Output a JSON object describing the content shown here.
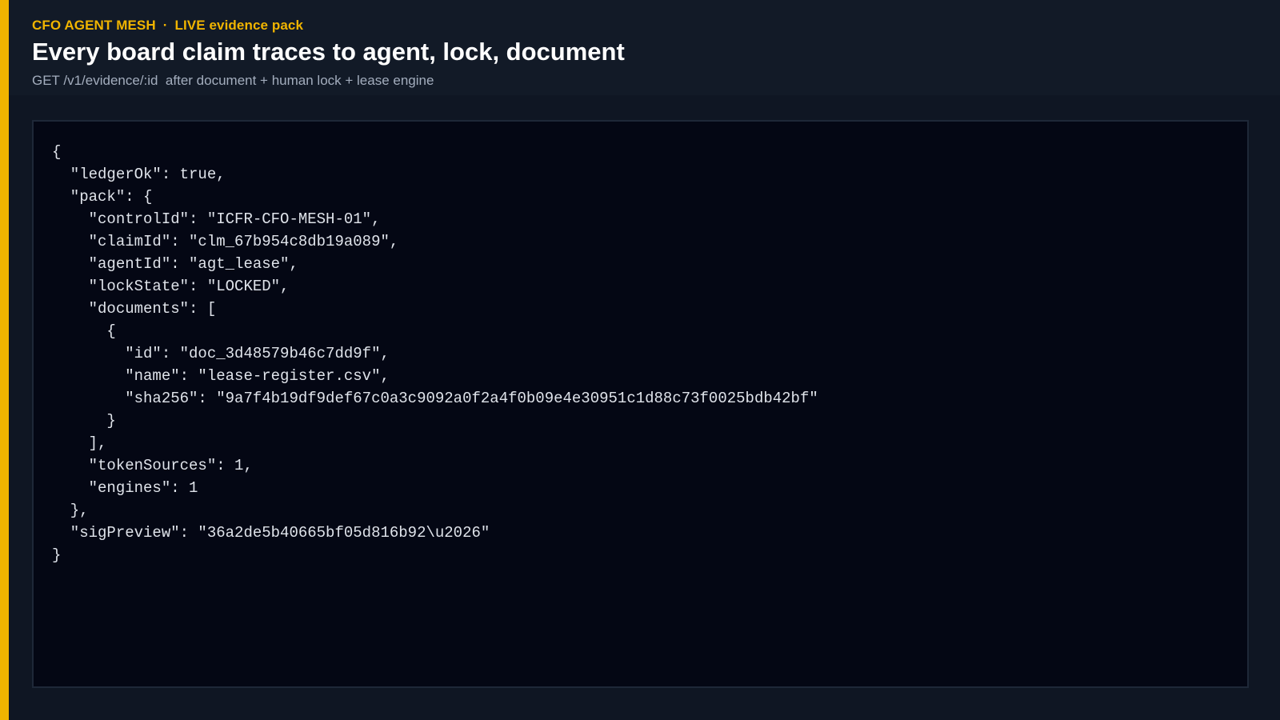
{
  "header": {
    "brand": "CFO AGENT MESH",
    "separator": "·",
    "status": "LIVE evidence pack",
    "title": "Every board claim traces to agent, lock, document",
    "subtitle": "GET /v1/evidence/:id  after document + human lock + lease engine"
  },
  "evidence_json": "{\n  \"ledgerOk\": true,\n  \"pack\": {\n    \"controlId\": \"ICFR-CFO-MESH-01\",\n    \"claimId\": \"clm_67b954c8db19a089\",\n    \"agentId\": \"agt_lease\",\n    \"lockState\": \"LOCKED\",\n    \"documents\": [\n      {\n        \"id\": \"doc_3d48579b46c7dd9f\",\n        \"name\": \"lease-register.csv\",\n        \"sha256\": \"9a7f4b19df9def67c0a3c9092a0f2a4f0b09e4e30951c1d88c73f0025bdb42bf\"\n      }\n    ],\n    \"tokenSources\": 1,\n    \"engines\": 1\n  },\n  \"sigPreview\": \"36a2de5b40665bf05d816b92\\u2026\"\n}",
  "colors": {
    "accent": "#f0b400",
    "background": "#0f1623",
    "header_background": "#121a27",
    "panel_background": "#040714",
    "panel_border": "#1e2838",
    "title": "#ffffff",
    "subtitle": "#a3adbd",
    "code_text": "#dfe3ea"
  }
}
